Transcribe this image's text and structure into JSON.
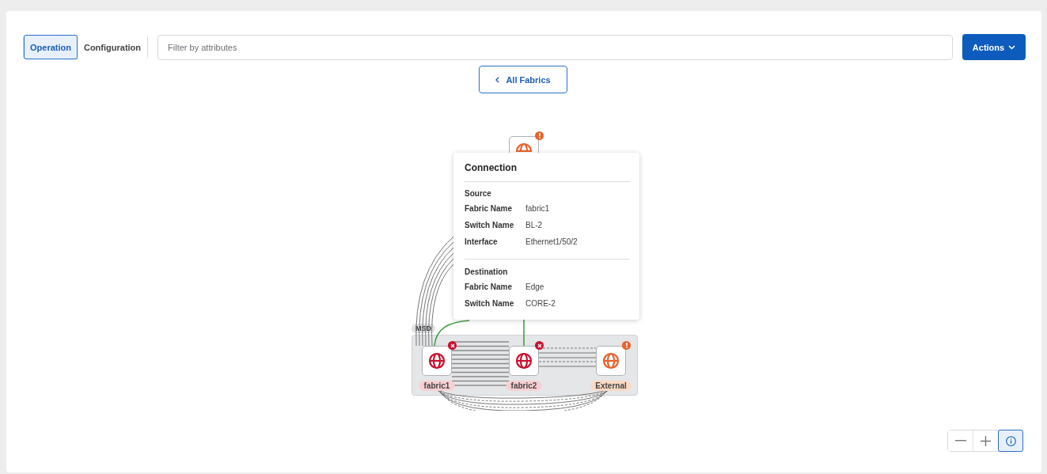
{
  "tabs": [
    {
      "label": "Operation",
      "selected": true
    },
    {
      "label": "Configuration",
      "selected": false
    }
  ],
  "filter": {
    "placeholder": "Filter by attributes"
  },
  "actions_button": {
    "label": "Actions"
  },
  "back_button": {
    "label": "All Fabrics"
  },
  "group": {
    "label": "MSD"
  },
  "nodes": [
    {
      "error": false
    },
    {
      "label": "fabric1",
      "error": true
    },
    {
      "label": "fabric2",
      "error": true
    },
    {
      "label": "External",
      "error": false
    }
  ],
  "tooltip": {
    "title": "Connection",
    "sections": [
      {
        "heading": "Source",
        "rows": [
          {
            "label": "Fabric Name",
            "value": "fabric1"
          },
          {
            "label": "Switch Name",
            "value": "BL-2"
          },
          {
            "label": "Interface",
            "value": "Ethernet1/50/2"
          }
        ]
      },
      {
        "heading": "Destination",
        "rows": [
          {
            "label": "Fabric Name",
            "value": "Edge"
          },
          {
            "label": "Switch Name",
            "value": "CORE-2"
          }
        ]
      }
    ]
  },
  "zoom_controls": [
    {
      "kind": "minus",
      "selected": false
    },
    {
      "kind": "plus",
      "selected": false
    },
    {
      "kind": "info",
      "selected": true
    }
  ]
}
